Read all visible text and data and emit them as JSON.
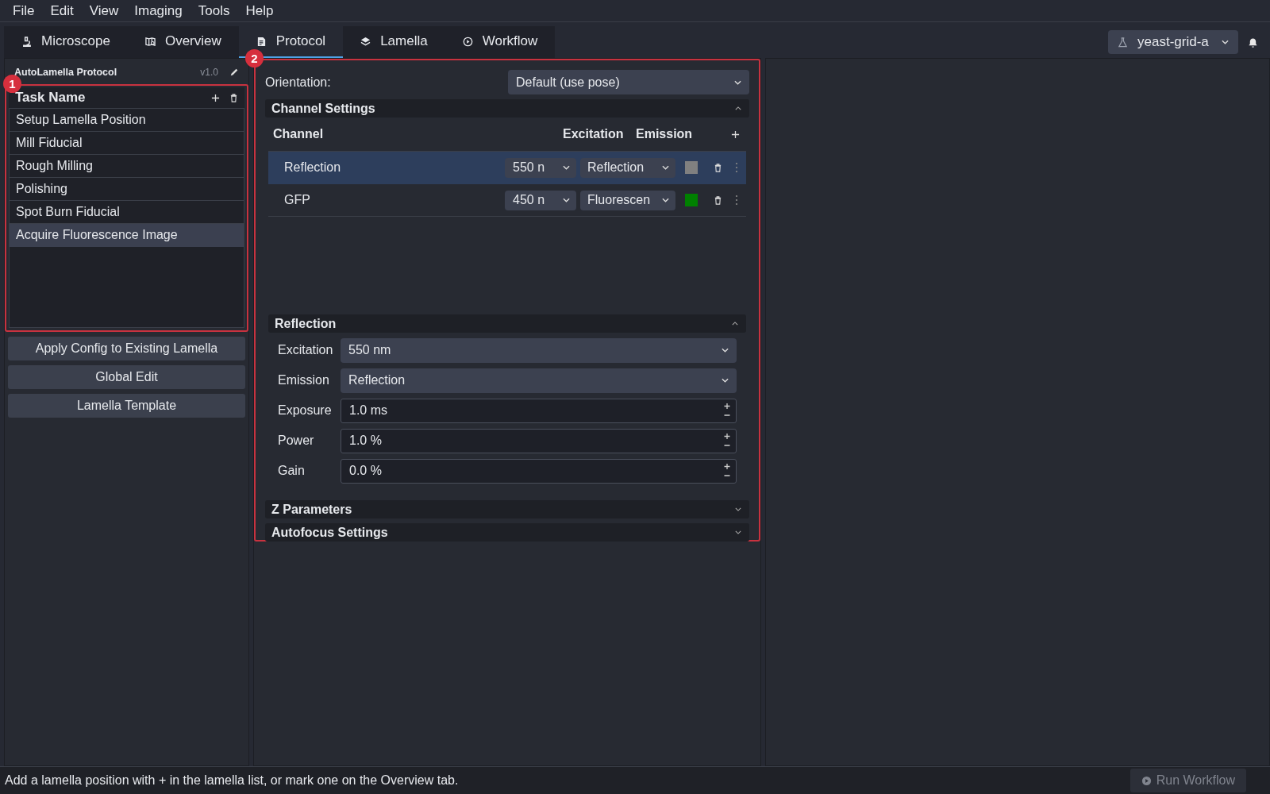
{
  "menu": [
    "File",
    "Edit",
    "View",
    "Imaging",
    "Tools",
    "Help"
  ],
  "tabs": [
    {
      "label": "Microscope",
      "selected": false,
      "kind": "microscope"
    },
    {
      "label": "Overview",
      "selected": false,
      "kind": "map"
    },
    {
      "label": "Protocol",
      "selected": true,
      "kind": "document"
    },
    {
      "label": "Lamella",
      "selected": false,
      "kind": "layers"
    },
    {
      "label": "Workflow",
      "selected": false,
      "kind": "play"
    }
  ],
  "project_selector": {
    "value": "yeast-grid-a"
  },
  "protocol": {
    "title": "AutoLamella Protocol",
    "version": "v1.0",
    "task_list": {
      "header": "Task Name",
      "items": [
        {
          "label": "Setup Lamella Position",
          "selected": false
        },
        {
          "label": "Mill Fiducial",
          "selected": false
        },
        {
          "label": "Rough Milling",
          "selected": false
        },
        {
          "label": "Polishing",
          "selected": false
        },
        {
          "label": "Spot Burn Fiducial",
          "selected": false
        },
        {
          "label": "Acquire Fluorescence Image",
          "selected": true
        }
      ]
    },
    "buttons": [
      "Apply Config to Existing Lamella",
      "Global Edit",
      "Lamella Template"
    ]
  },
  "orientation": {
    "label": "Orientation:",
    "value": "Default (use pose)"
  },
  "channel_settings": {
    "title": "Channel Settings",
    "expanded": true,
    "columns": [
      "Channel",
      "Excitation",
      "Emission"
    ],
    "channels": [
      {
        "name": "Reflection",
        "excitation": "550 n",
        "emission": "Reflection",
        "color": "#808080",
        "selected": true
      },
      {
        "name": "GFP",
        "excitation": "450 n",
        "emission": "Fluorescen",
        "color": "#008000",
        "selected": false
      }
    ]
  },
  "channel_detail": {
    "title": "Reflection",
    "expanded": true,
    "fields": [
      {
        "label": "Excitation",
        "value": "550 nm",
        "kind": "select"
      },
      {
        "label": "Emission",
        "value": "Reflection",
        "kind": "select"
      },
      {
        "label": "Exposure",
        "value": "1.0 ms",
        "kind": "spin"
      },
      {
        "label": "Power",
        "value": "1.0 %",
        "kind": "spin"
      },
      {
        "label": "Gain",
        "value": "0.0 %",
        "kind": "spin"
      }
    ]
  },
  "collapsed_sections": [
    {
      "title": "Z Parameters",
      "expanded": false
    },
    {
      "title": "Autofocus Settings",
      "expanded": false
    }
  ],
  "annotations": [
    {
      "label": "1"
    },
    {
      "label": "2"
    }
  ],
  "status_bar": {
    "message": "Add a lamella position with + in the lamella list, or mark one on the Overview tab.",
    "run_button": {
      "label": "Run Workflow",
      "disabled": true
    }
  }
}
